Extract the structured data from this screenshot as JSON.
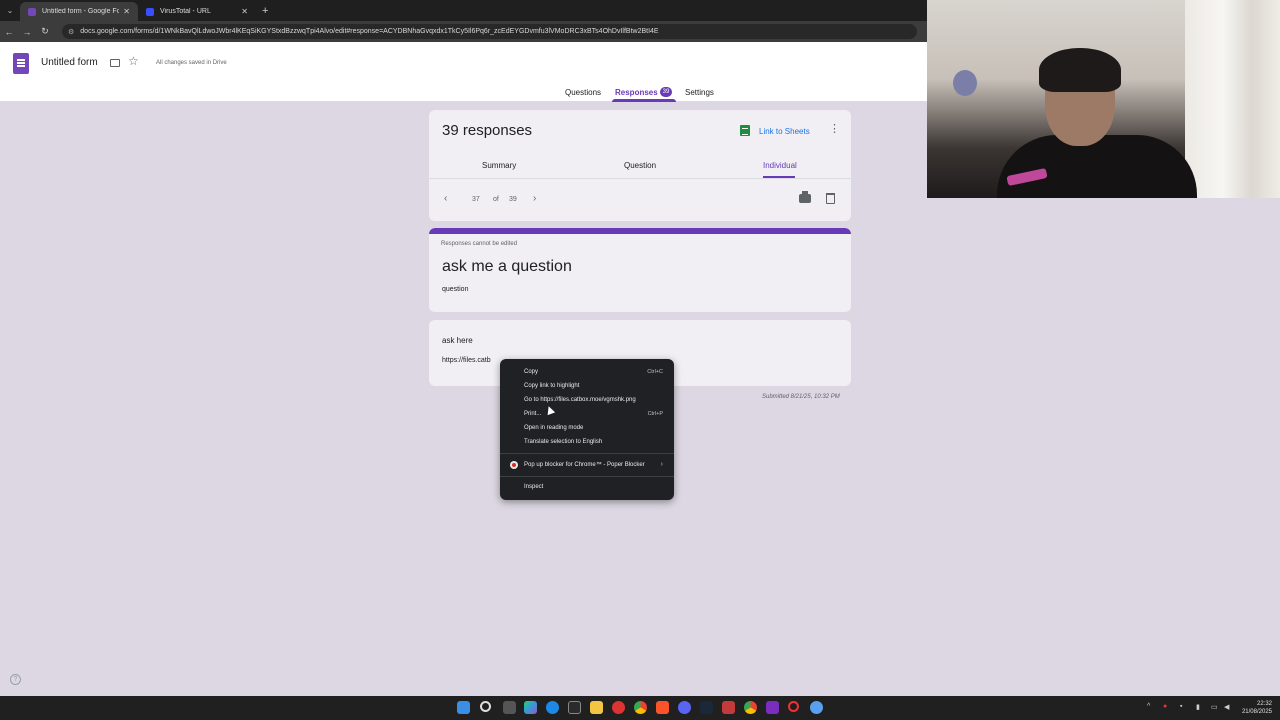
{
  "browser": {
    "tabs": [
      {
        "title": "Untitled form - Google Forms",
        "active": true
      },
      {
        "title": "VirusTotal - URL",
        "active": false
      }
    ],
    "url": "docs.google.com/forms/d/1WNkBavQlLdwoJWbr4lKEqSiKGYStxdBzzwqTpi4Alvo/edit#response=ACYDBNhaGvqxdx1TkCy5Il6Pq6r_zcEdEYGDvmfu3lVMoDRC3xBTs4OhDvIlfBtw2BtI4E"
  },
  "header": {
    "form_title": "Untitled form",
    "saved_status": "All changes saved in Drive",
    "tabs": {
      "questions": "Questions",
      "responses": "Responses",
      "responses_count": "39",
      "settings": "Settings"
    }
  },
  "summary": {
    "count_label": "39 responses",
    "link_to_sheets": "Link to Sheets",
    "subtabs": {
      "summary": "Summary",
      "question": "Question",
      "individual": "Individual"
    },
    "pager": {
      "current": "37",
      "of": "of",
      "total": "39"
    }
  },
  "form": {
    "notice": "Responses cannot be edited",
    "title": "ask me a question",
    "description": "question"
  },
  "answer": {
    "label": "ask here",
    "value": "https://files.catb"
  },
  "submitted": "Submitted 8/21/25, 10:32 PM",
  "context_menu": {
    "copy": "Copy",
    "copy_shortcut": "Ctrl+C",
    "copy_link": "Copy link to highlight",
    "goto": "Go to https://files.catbox.moe/vgmshk.png",
    "print": "Print...",
    "print_shortcut": "Ctrl+P",
    "reading_mode": "Open in reading mode",
    "translate": "Translate selection to English",
    "extension": "Pop up blocker for Chrome™ - Poper Blocker",
    "inspect": "Inspect"
  },
  "taskbar": {
    "time": "22:32",
    "date": "21/08/2025"
  },
  "colors": {
    "accent": "#673ab7",
    "page_bg": "#dcd7e2",
    "card_bg": "#f1eff4",
    "menu_bg": "#202124"
  }
}
